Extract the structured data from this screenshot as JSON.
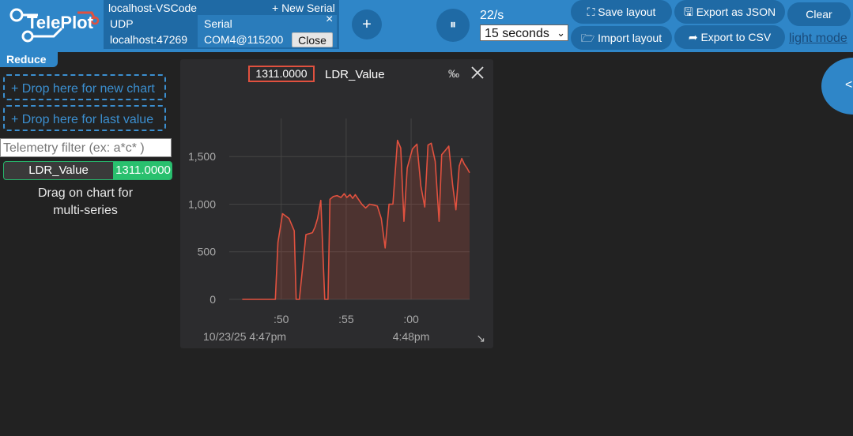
{
  "app": {
    "logo_text": "TelePlot"
  },
  "connection": {
    "host_label": "localhost-VSCode",
    "new_serial_label": "+ New Serial",
    "protocol": "UDP",
    "address": "localhost:47269",
    "serial_label": "Serial",
    "close_x": "×",
    "port": "COM4@115200",
    "close_button": "Close"
  },
  "toolbar": {
    "add_label": "+",
    "pause_label": "⏸",
    "rate": "22/s",
    "window_selected": "15 seconds",
    "save_layout": "⛶ Save layout",
    "import_layout": "🗁 Import layout",
    "export_json": "🖫 Export as JSON",
    "export_csv": "➦ Export to CSV",
    "clear": "Clear",
    "light_mode": "light mode"
  },
  "sidebar": {
    "reduce_label": "Reduce",
    "drop_new_chart": "+ Drop here for new chart",
    "drop_last_value": "+ Drop here for last value",
    "filter_placeholder": "Telemetry filter (ex: a*c* )",
    "telemetry": [
      {
        "name": "LDR_Value",
        "value": "1311.0000"
      }
    ],
    "hint_line1": "Drag on chart for",
    "hint_line2": "multi-series"
  },
  "right_toggle": {
    "label": "<"
  },
  "chart_panel": {
    "current_value": "1311.0000",
    "series_label": "LDR_Value",
    "permille_icon": "‰",
    "close_icon": "close-icon",
    "resize_icon": "↘"
  },
  "colors": {
    "accent": "#2f86c8",
    "series": "#e1513f",
    "value_green": "#29c06e"
  },
  "chart_data": {
    "type": "area",
    "series": [
      {
        "name": "LDR_Value",
        "x": [
          47.0,
          47.5,
          47.8,
          48.0,
          48.3,
          48.7,
          49.1,
          49.35,
          49.55,
          49.75,
          50.1,
          50.6,
          51.0,
          51.15,
          51.4,
          51.9,
          52.4,
          52.6,
          52.8,
          53.05,
          53.35,
          53.6,
          53.75,
          54.0,
          54.3,
          54.6,
          54.85,
          55.05,
          55.3,
          55.5,
          55.7,
          55.95,
          56.2,
          56.5,
          56.8,
          57.15,
          57.4,
          57.7,
          58.0,
          58.3,
          58.6,
          58.95,
          59.2,
          59.45,
          59.7,
          60.1,
          60.45,
          60.75,
          61.05,
          61.3,
          61.55,
          61.85,
          62.15,
          62.35,
          62.6,
          62.9,
          63.2,
          63.45,
          63.7,
          63.9,
          64.1,
          64.3,
          64.5
        ],
        "values": [
          0,
          0,
          0,
          0,
          0,
          0,
          0,
          0,
          0,
          600,
          900,
          850,
          720,
          0,
          0,
          680,
          700,
          760,
          850,
          1040,
          0,
          0,
          1050,
          1080,
          1090,
          1070,
          1110,
          1070,
          1100,
          1060,
          1100,
          1050,
          1000,
          960,
          1000,
          990,
          980,
          850,
          540,
          1000,
          1000,
          1670,
          1590,
          820,
          1380,
          1580,
          1630,
          1190,
          970,
          1620,
          1640,
          1450,
          820,
          1520,
          1560,
          1610,
          1200,
          940,
          1400,
          1480,
          1420,
          1380,
          1330
        ]
      }
    ],
    "xticks": [
      ":50",
      ":55",
      ":00"
    ],
    "xtick_values": [
      50,
      55,
      60
    ],
    "date_labels": [
      "10/23/25 4:47pm",
      "4:48pm"
    ],
    "yticks": [
      "0",
      "500",
      "1,000",
      "1,500"
    ],
    "ytick_values": [
      0,
      500,
      1000,
      1500
    ],
    "ylim": [
      0,
      1900
    ],
    "xlim": [
      46.0,
      64.5
    ],
    "grid": true,
    "legend": "top"
  }
}
